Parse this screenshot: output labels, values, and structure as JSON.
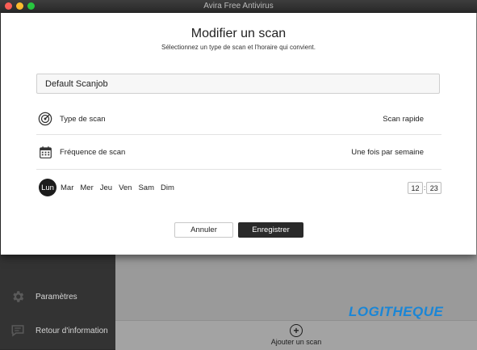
{
  "window": {
    "title": "Avira Free Antivirus"
  },
  "modal": {
    "title": "Modifier un scan",
    "subtitle": "Sélectionnez un type de scan et l'horaire qui convient.",
    "scan_name": "Default Scanjob",
    "scan_type": {
      "label": "Type de scan",
      "value": "Scan rapide",
      "icon": "radar-icon"
    },
    "frequency": {
      "label": "Fréquence de scan",
      "value": "Une fois par semaine",
      "icon": "calendar-icon"
    },
    "days": [
      "Lun",
      "Mar",
      "Mer",
      "Jeu",
      "Ven",
      "Sam",
      "Dim"
    ],
    "selected_day": "Lun",
    "time": {
      "hour": "12",
      "minute": "23",
      "separator": ":"
    },
    "cancel_label": "Annuler",
    "save_label": "Enregistrer"
  },
  "sidebar": {
    "items": [
      {
        "label": "Paramètres",
        "icon": "gear-icon"
      },
      {
        "label": "Retour d'information",
        "icon": "feedback-icon"
      }
    ]
  },
  "footer": {
    "add_scan_label": "Ajouter un scan",
    "add_icon": "plus-circle-icon"
  },
  "watermark": "LOGITHEQUE",
  "colors": {
    "titlebar": "#2a2a2a",
    "sidebar": "#333333",
    "main_bg": "#9a9a9a",
    "modal_bg": "#ffffff",
    "primary_button": "#2a2a2a",
    "watermark": "#1a86d6"
  }
}
